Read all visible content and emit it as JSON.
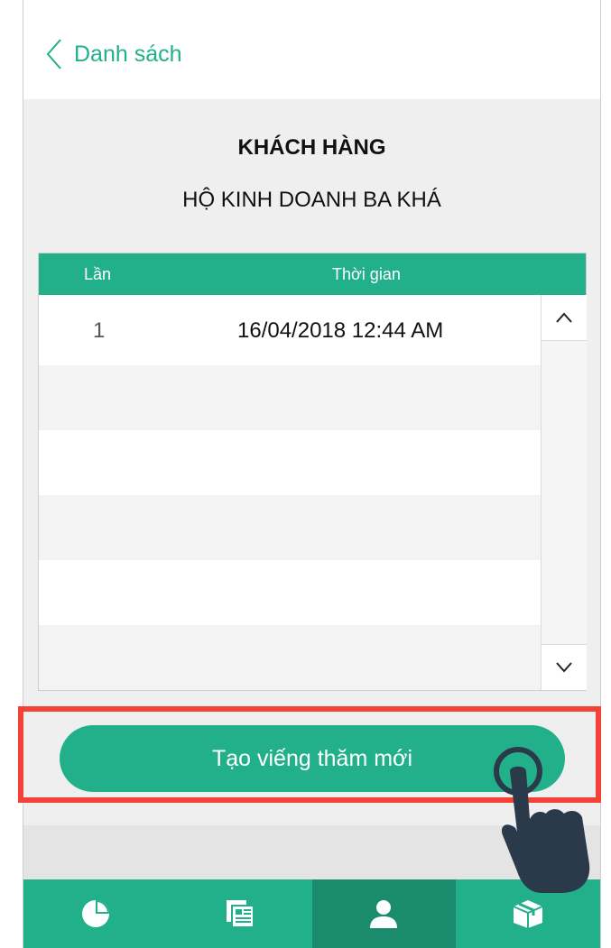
{
  "header": {
    "back_label": "Danh sách"
  },
  "customer": {
    "title": "KHÁCH HÀNG",
    "name": "HỘ KINH DOANH BA KHÁ"
  },
  "table": {
    "columns": [
      "Lần",
      "Thời gian"
    ],
    "rows": [
      {
        "lan": "1",
        "time": "16/04/2018 12:44 AM"
      },
      {
        "lan": "",
        "time": ""
      },
      {
        "lan": "",
        "time": ""
      },
      {
        "lan": "",
        "time": ""
      },
      {
        "lan": "",
        "time": ""
      },
      {
        "lan": "",
        "time": ""
      }
    ]
  },
  "actions": {
    "new_visit_label": "Tạo viếng thăm mới"
  },
  "tabs": [
    {
      "icon": "pie-chart-icon"
    },
    {
      "icon": "document-icon"
    },
    {
      "icon": "user-icon",
      "active": true
    },
    {
      "icon": "box-icon"
    }
  ],
  "colors": {
    "accent": "#22b08a",
    "accent_dark": "#1a8b6d",
    "highlight": "#f44236"
  }
}
